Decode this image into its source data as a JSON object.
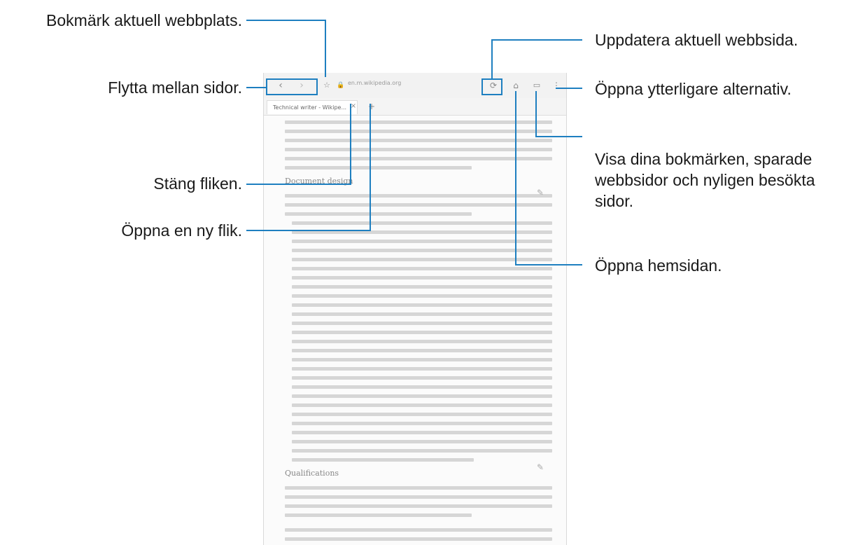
{
  "callouts": {
    "bookmark": "Bokmärk aktuell webbplats.",
    "navigate": "Flytta mellan sidor.",
    "close_tab": "Stäng fliken.",
    "new_tab": "Öppna en ny flik.",
    "refresh": "Uppdatera aktuell webbsida.",
    "more_options": "Öppna ytterligare alternativ.",
    "bookmarks_view": "Visa dina bokmärken, sparade webbsidor och nyligen besökta sidor.",
    "home": "Öppna hemsidan."
  },
  "browser": {
    "url": "en.m.wikipedia.org",
    "tab_title": "Technical writer - Wikipe...",
    "section1": "Document design",
    "section2": "Qualifications"
  },
  "colors": {
    "leader": "#1e7fc0"
  },
  "icons": [
    "back-icon",
    "forward-icon",
    "bookmark-star-icon",
    "lock-icon",
    "refresh-icon",
    "home-icon",
    "bookmarks-icon",
    "more-icon",
    "close-icon",
    "plus-icon",
    "edit-icon"
  ]
}
